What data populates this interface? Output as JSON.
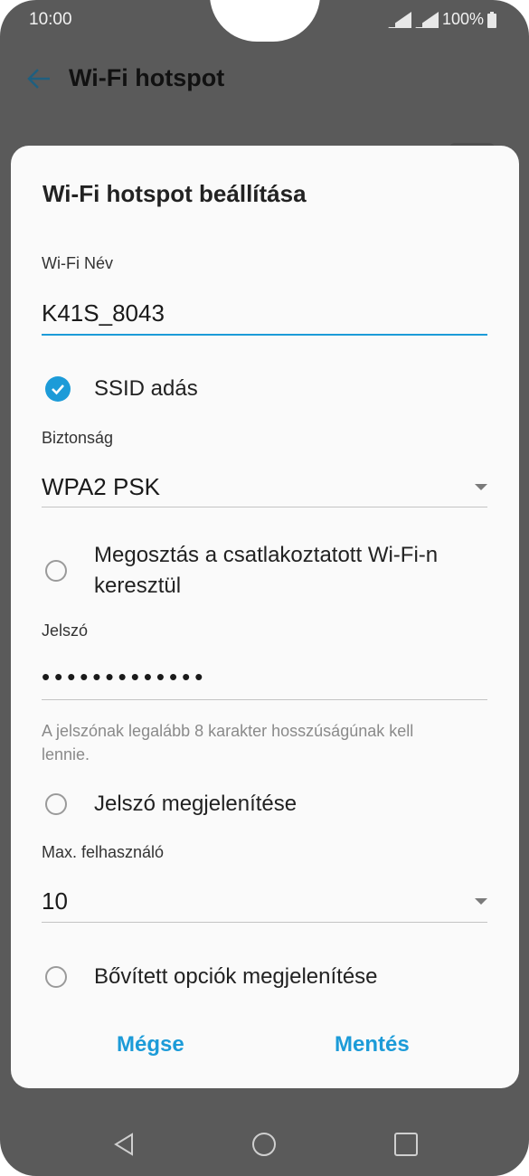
{
  "status": {
    "time": "10:00",
    "battery": "100%"
  },
  "appbar": {
    "title": "Wi-Fi hotspot"
  },
  "dialog": {
    "title": "Wi-Fi hotspot beállítása",
    "wifi_name_label": "Wi-Fi Név",
    "wifi_name_value": "K41S_8043",
    "ssid_broadcast": {
      "label": "SSID adás",
      "checked": true
    },
    "security_label": "Biztonság",
    "security_value": "WPA2 PSK",
    "share_connected": {
      "label_line1": "Megosztás a csatlakoztatott Wi-Fi-n",
      "label_line2": "keresztül",
      "checked": false
    },
    "password_label": "Jelszó",
    "password_masked": "•••••••••••••",
    "password_hint_line1": "A jelszónak legalább 8 karakter hosszúságúnak kell",
    "password_hint_line2": "lennie.",
    "show_password": {
      "label": "Jelszó megjelenítése",
      "checked": false
    },
    "max_users_label": "Max. felhasználó",
    "max_users_value": "10",
    "advanced_options": {
      "label": "Bővített opciók megjelenítése",
      "checked": false
    },
    "cancel_label": "Mégse",
    "save_label": "Mentés"
  },
  "colors": {
    "accent": "#1c9bd8",
    "scrim": "#5a5a5a",
    "dialog_bg": "#fafafa"
  },
  "icons": {
    "back": "arrow-left-icon",
    "check": "check-icon",
    "dropdown": "chevron-down-icon",
    "nav_back": "triangle-back-icon",
    "nav_home": "circle-home-icon",
    "nav_recent": "square-recent-icon"
  }
}
